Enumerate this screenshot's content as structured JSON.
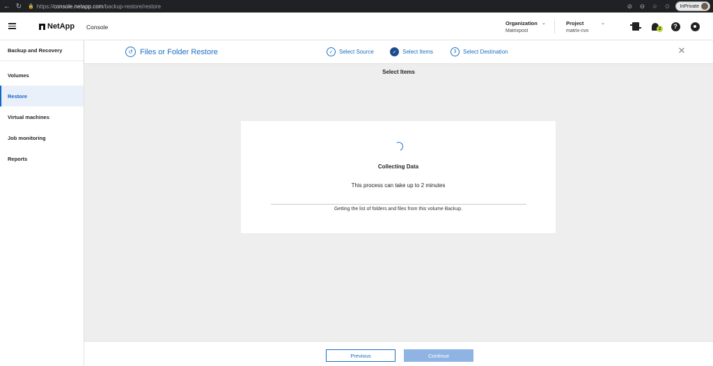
{
  "browser": {
    "url_scheme": "https://",
    "url_host": "console.netapp.com",
    "url_path": "/backup-restore/restore",
    "inprivate_label": "InPrivate"
  },
  "header": {
    "brand": "NetApp",
    "console_label": "Console",
    "organization": {
      "label": "Organization",
      "value": "Matrixpost"
    },
    "project": {
      "label": "Project",
      "value": "matrix-cvo"
    },
    "notification_count": "2",
    "help_glyph": "?"
  },
  "sidebar": {
    "title": "Backup and Recovery",
    "items": [
      {
        "label": "Volumes",
        "active": false
      },
      {
        "label": "Restore",
        "active": true
      },
      {
        "label": "Virtual machines",
        "active": false
      },
      {
        "label": "Job monitoring",
        "active": false
      },
      {
        "label": "Reports",
        "active": false
      }
    ]
  },
  "wizard": {
    "title": "Files or Folder Restore",
    "steps": [
      {
        "label": "Select Source",
        "state": "done"
      },
      {
        "label": "Select Items",
        "state": "current"
      },
      {
        "label": "Select Destination",
        "number": "3",
        "state": "pending"
      }
    ],
    "close_glyph": "✕"
  },
  "main": {
    "section_title": "Select Items",
    "status_title": "Collecting Data",
    "status_message": "This process can take up to 2 minutes",
    "progress": 0,
    "detail": "Getting the list of folders and files from this volume Backup."
  },
  "footer": {
    "previous_label": "Previous",
    "continue_label": "Continue"
  },
  "colors": {
    "accent": "#1a6ec2",
    "active_step": "#1b4b8f",
    "badge": "#b6d635",
    "disabled_button": "#8fb4e3"
  },
  "icons": {
    "back": "arrow-left-icon",
    "reload": "refresh-icon",
    "lock": "lock-icon",
    "connector": "connector-icon",
    "bell": "bell-icon",
    "help": "help-icon",
    "user": "user-icon",
    "wizard": "restore-icon",
    "spinner": "spinner-icon"
  }
}
